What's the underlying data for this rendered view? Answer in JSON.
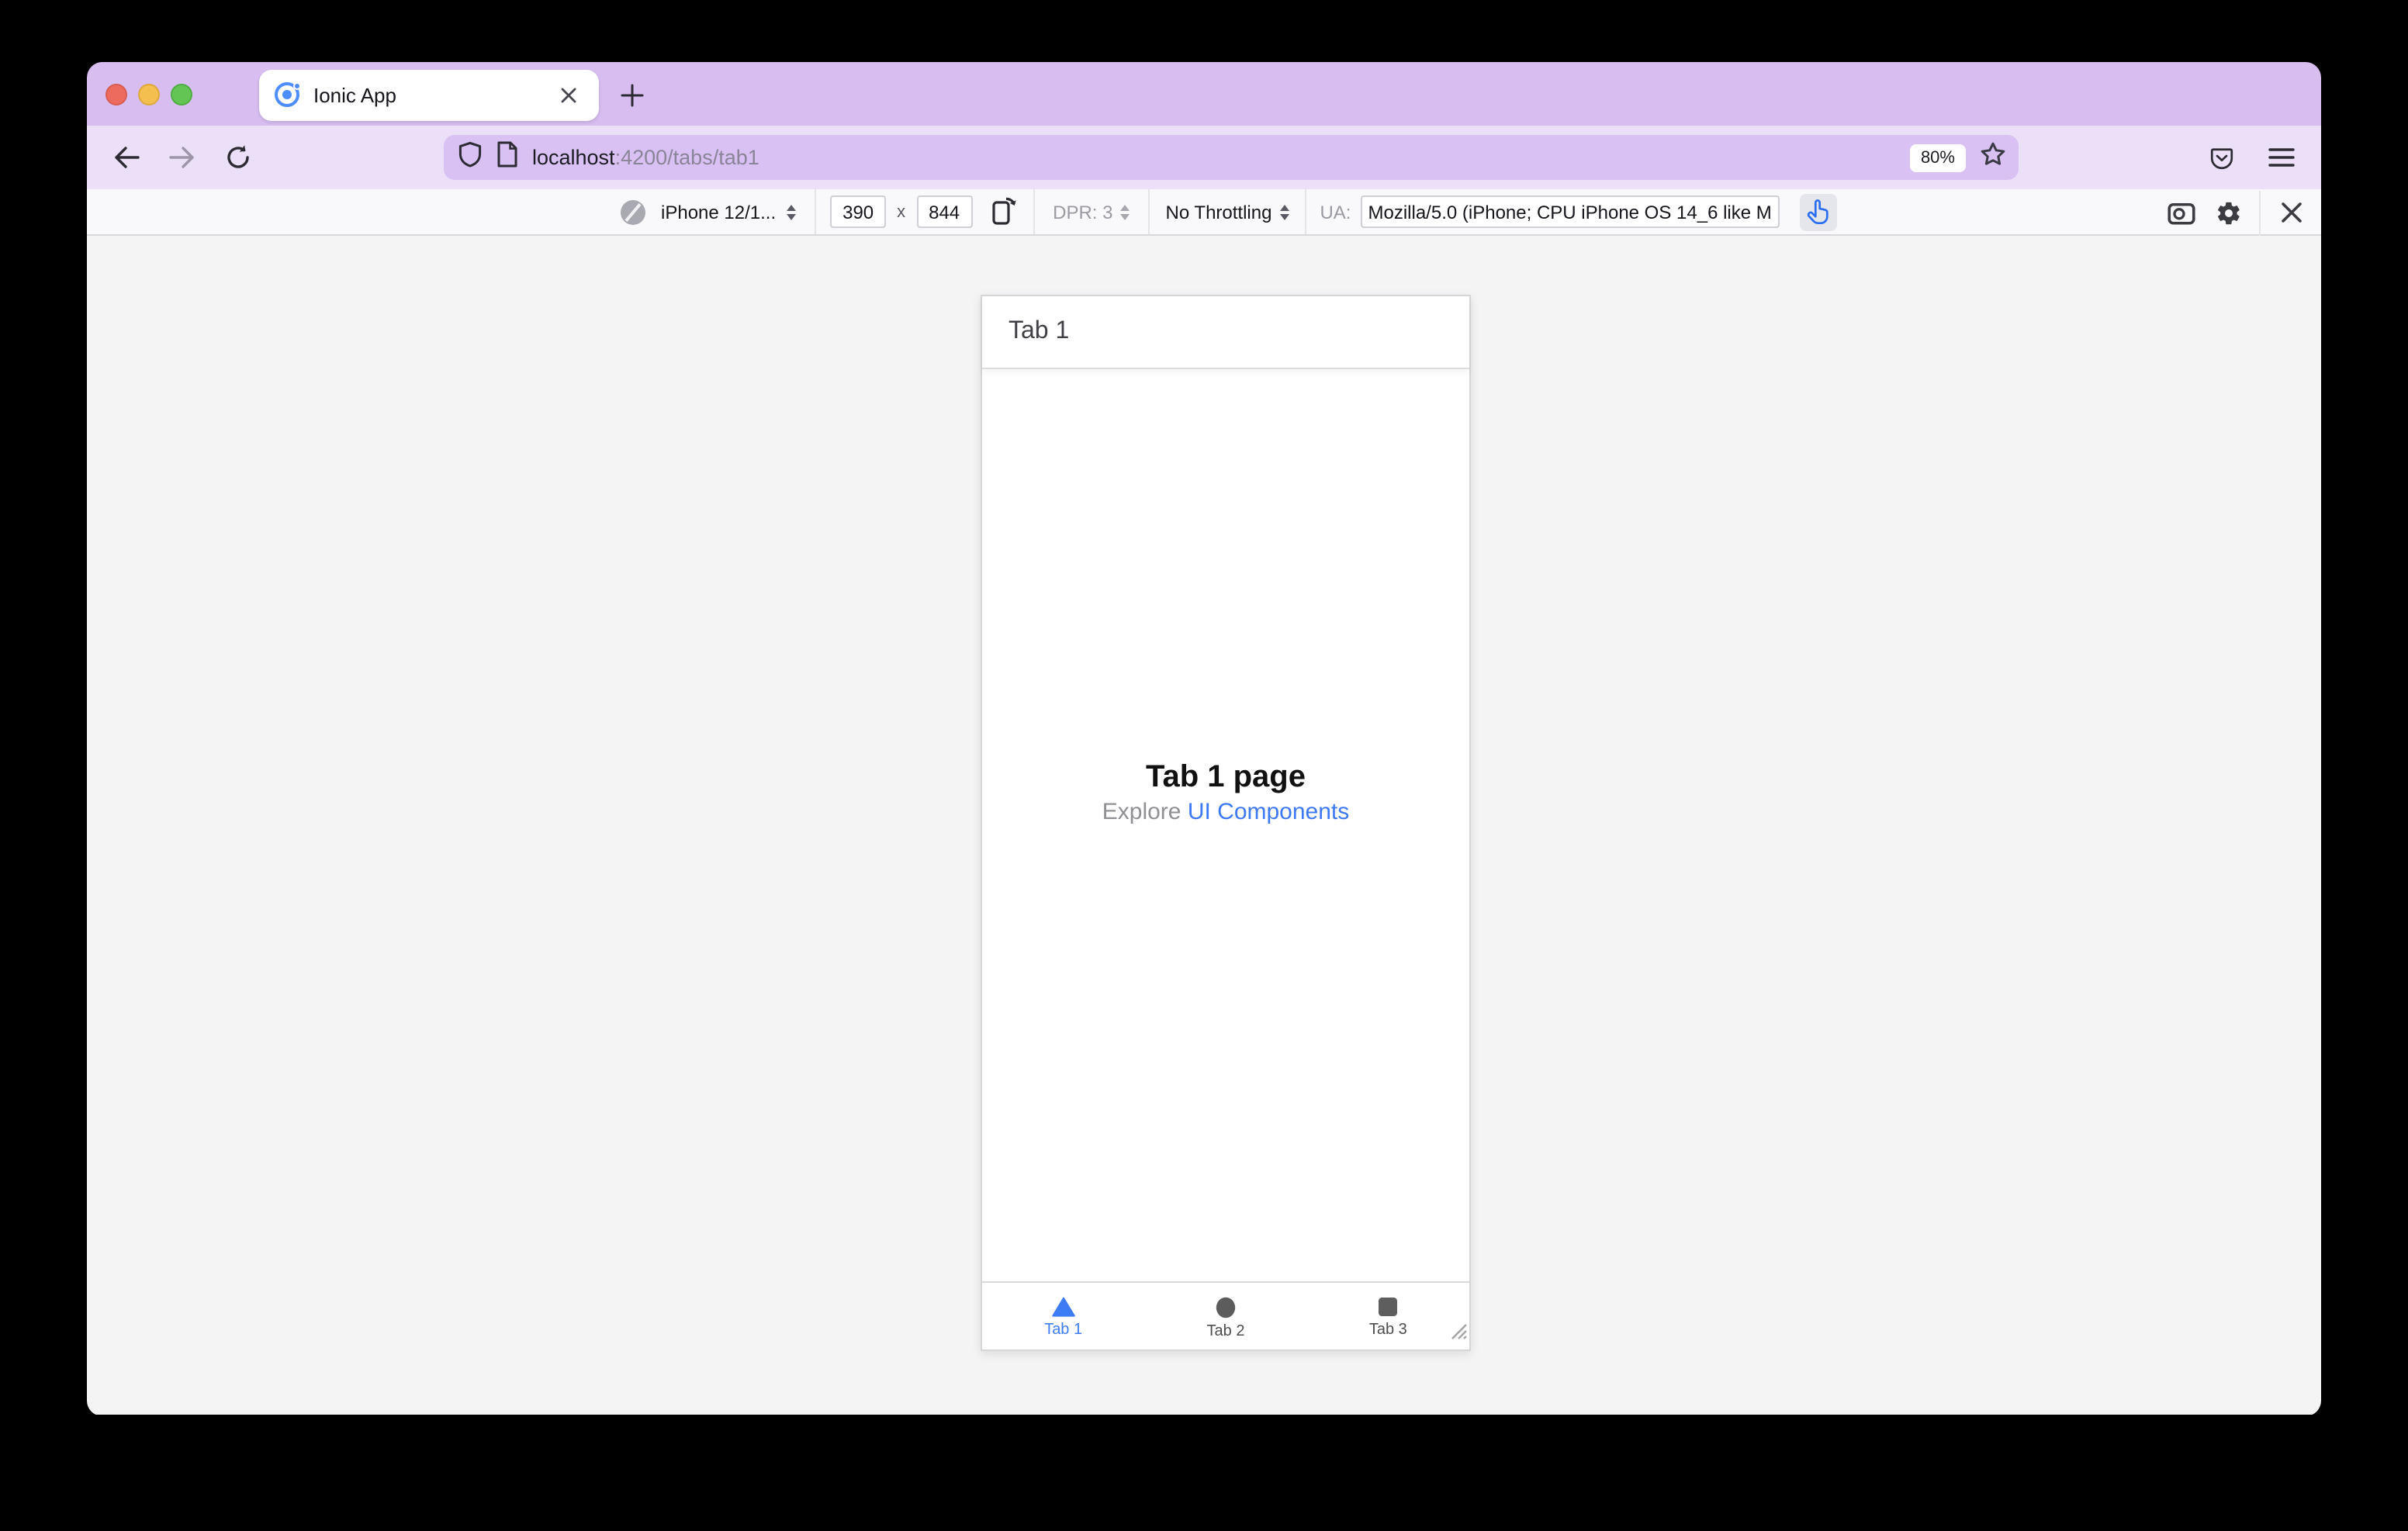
{
  "browser": {
    "tab_title": "Ionic App",
    "url_host": "localhost",
    "url_rest": ":4200/tabs/tab1",
    "zoom_level": "80%"
  },
  "rdm_toolbar": {
    "device_label": "iPhone 12/1...",
    "width_value": "390",
    "dimension_separator": "x",
    "height_value": "844",
    "dpr_label": "DPR: 3",
    "throttling_label": "No Throttling",
    "ua_label": "UA:",
    "ua_value": "Mozilla/5.0 (iPhone; CPU iPhone OS 14_6 like M"
  },
  "app": {
    "header_title": "Tab 1",
    "page_title": "Tab 1 page",
    "subtitle_prefix": "Explore ",
    "subtitle_link": "UI Components",
    "tabs": [
      {
        "label": "Tab 1",
        "active": true
      },
      {
        "label": "Tab 2",
        "active": false
      },
      {
        "label": "Tab 3",
        "active": false
      }
    ]
  },
  "colors": {
    "accent_blue": "#3d7cf5",
    "tab_strip_bg": "#d7bdf0",
    "toolbar_bg": "#ecdff8",
    "url_field_bg": "#d9c1f3",
    "content_bg": "#f4f4f5"
  }
}
